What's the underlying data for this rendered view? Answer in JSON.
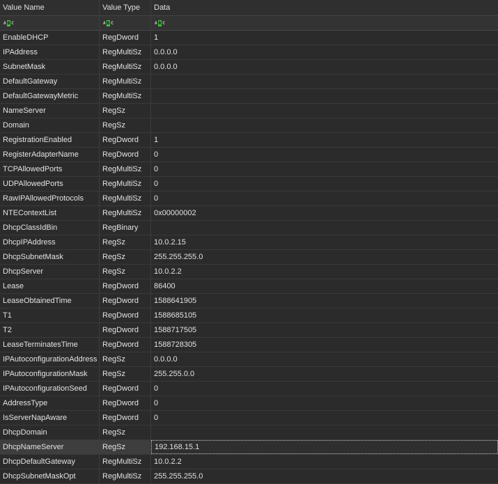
{
  "columns": {
    "name": "Value Name",
    "type": "Value Type",
    "data": "Data"
  },
  "filter_icon": {
    "left": "A",
    "mid": "B",
    "right": "C"
  },
  "rows": [
    {
      "name": "EnableDHCP",
      "type": "RegDword",
      "data": "1"
    },
    {
      "name": "IPAddress",
      "type": "RegMultiSz",
      "data": "0.0.0.0"
    },
    {
      "name": "SubnetMask",
      "type": "RegMultiSz",
      "data": "0.0.0.0"
    },
    {
      "name": "DefaultGateway",
      "type": "RegMultiSz",
      "data": ""
    },
    {
      "name": "DefaultGatewayMetric",
      "type": "RegMultiSz",
      "data": ""
    },
    {
      "name": "NameServer",
      "type": "RegSz",
      "data": ""
    },
    {
      "name": "Domain",
      "type": "RegSz",
      "data": ""
    },
    {
      "name": "RegistrationEnabled",
      "type": "RegDword",
      "data": "1"
    },
    {
      "name": "RegisterAdapterName",
      "type": "RegDword",
      "data": "0"
    },
    {
      "name": "TCPAllowedPorts",
      "type": "RegMultiSz",
      "data": "0"
    },
    {
      "name": "UDPAllowedPorts",
      "type": "RegMultiSz",
      "data": "0"
    },
    {
      "name": "RawIPAllowedProtocols",
      "type": "RegMultiSz",
      "data": "0"
    },
    {
      "name": "NTEContextList",
      "type": "RegMultiSz",
      "data": "0x00000002"
    },
    {
      "name": "DhcpClassIdBin",
      "type": "RegBinary",
      "data": ""
    },
    {
      "name": "DhcpIPAddress",
      "type": "RegSz",
      "data": "10.0.2.15"
    },
    {
      "name": "DhcpSubnetMask",
      "type": "RegSz",
      "data": "255.255.255.0"
    },
    {
      "name": "DhcpServer",
      "type": "RegSz",
      "data": "10.0.2.2"
    },
    {
      "name": "Lease",
      "type": "RegDword",
      "data": "86400"
    },
    {
      "name": "LeaseObtainedTime",
      "type": "RegDword",
      "data": "1588641905"
    },
    {
      "name": "T1",
      "type": "RegDword",
      "data": "1588685105"
    },
    {
      "name": "T2",
      "type": "RegDword",
      "data": "1588717505"
    },
    {
      "name": "LeaseTerminatesTime",
      "type": "RegDword",
      "data": "1588728305"
    },
    {
      "name": "IPAutoconfigurationAddress",
      "type": "RegSz",
      "data": "0.0.0.0"
    },
    {
      "name": "IPAutoconfigurationMask",
      "type": "RegSz",
      "data": "255.255.0.0"
    },
    {
      "name": "IPAutoconfigurationSeed",
      "type": "RegDword",
      "data": "0"
    },
    {
      "name": "AddressType",
      "type": "RegDword",
      "data": "0"
    },
    {
      "name": "IsServerNapAware",
      "type": "RegDword",
      "data": "0"
    },
    {
      "name": "DhcpDomain",
      "type": "RegSz",
      "data": ""
    },
    {
      "name": "DhcpNameServer",
      "type": "RegSz",
      "data": "192.168.15.1",
      "selected": true
    },
    {
      "name": "DhcpDefaultGateway",
      "type": "RegMultiSz",
      "data": "10.0.2.2"
    },
    {
      "name": "DhcpSubnetMaskOpt",
      "type": "RegMultiSz",
      "data": "255.255.255.0"
    }
  ]
}
